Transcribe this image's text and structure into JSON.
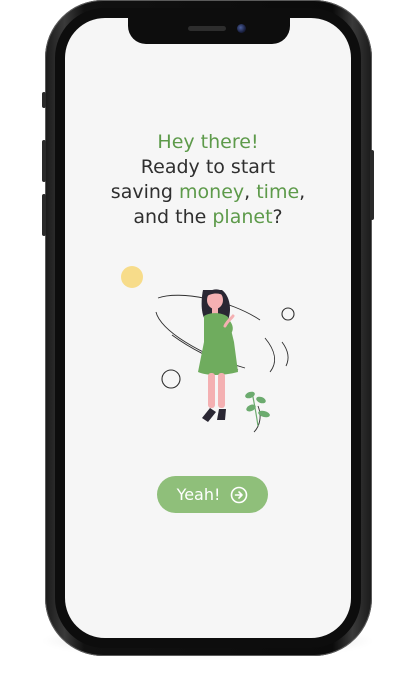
{
  "onboarding": {
    "headline": {
      "line1": "Hey there!",
      "line2": "Ready to start",
      "line3_prefix": "saving ",
      "money": "money",
      "comma1": ", ",
      "time": "time",
      "comma2": ",",
      "line4_prefix": "and the ",
      "planet": "planet",
      "question_mark": "?"
    },
    "cta": {
      "label": "Yeah!",
      "icon": "arrow-right-circle-icon"
    }
  },
  "colors": {
    "accent_green": "#5d9a4a",
    "button_green": "#8fbf7a",
    "screen_bg": "#f6f6f6",
    "text_dark": "#2f2f2f",
    "sun_yellow": "#f7dc8a"
  }
}
